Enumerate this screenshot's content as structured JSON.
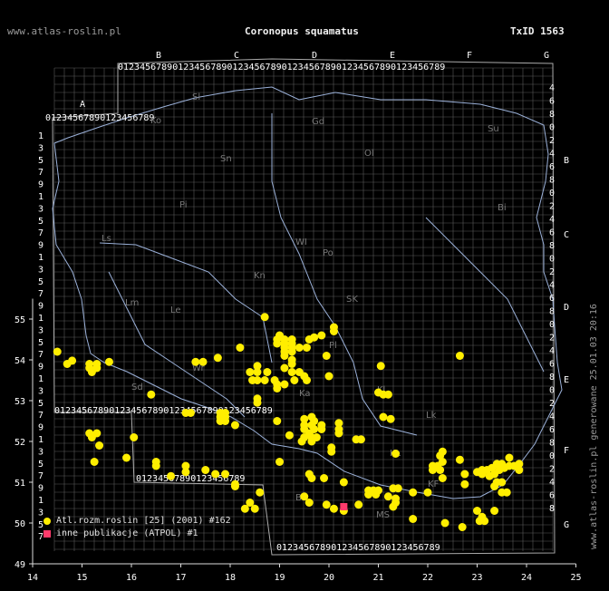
{
  "header": {
    "site": "www.atlas-roslin.pl",
    "species": "Coronopus squamatus",
    "taxid": "TxID 1563"
  },
  "side_label": "www.atlas-roslin.pl generowane 25.01.03 20:16",
  "axes": {
    "lon_ticks": [
      "14",
      "15",
      "16",
      "17",
      "18",
      "19",
      "20",
      "21",
      "22",
      "23",
      "24",
      "25"
    ],
    "lat_ticks": [
      "49",
      "50",
      "51",
      "52",
      "53",
      "54",
      "55"
    ]
  },
  "atpol": {
    "top_letters": [
      "B",
      "C",
      "D",
      "E",
      "F",
      "G"
    ],
    "left_letters": [
      "A"
    ],
    "right_letters": [
      "B",
      "C",
      "D",
      "E",
      "F",
      "G"
    ],
    "digits": "0123456789",
    "row_digits_left": [
      "1",
      "3",
      "5",
      "7",
      "9",
      "1",
      "3",
      "5",
      "7",
      "9",
      "1",
      "3",
      "5",
      "7",
      "9",
      "1",
      "3",
      "5",
      "7",
      "9",
      "1",
      "3",
      "5",
      "7",
      "9",
      "1",
      "3",
      "5",
      "7",
      "9",
      "1",
      "3",
      "5",
      "7"
    ],
    "row_digits_right": [
      "4",
      "6",
      "8",
      "0",
      "2",
      "4",
      "6",
      "8",
      "0",
      "2",
      "4",
      "6",
      "8",
      "0",
      "2",
      "4",
      "6",
      "8",
      "0",
      "2",
      "4",
      "6",
      "8",
      "0",
      "2",
      "4",
      "6",
      "8",
      "0",
      "2",
      "4",
      "6",
      "8"
    ],
    "regions": [
      "Sl",
      "Ko",
      "Gd",
      "Ol",
      "Su",
      "Sn",
      "Bi",
      "Pi",
      "WI",
      "Po",
      "Ls",
      "SK",
      "Kn",
      "Pl",
      "Lm",
      "Le",
      "Wr",
      "Sd",
      "Ka",
      "Kl",
      "Lk",
      "KL",
      "KF",
      "BB",
      "MS"
    ]
  },
  "legend": [
    {
      "marker": "circle",
      "color": "#ffee00",
      "label": "Atl.rozm.roslin [25] (2001) #162"
    },
    {
      "marker": "square",
      "color": "#ff3b6b",
      "label": "inne publikacje (ATPOL) #1"
    }
  ],
  "records": {
    "primary": [
      [
        14.5,
        54.2
      ],
      [
        14.7,
        53.9
      ],
      [
        14.8,
        53.98
      ],
      [
        15.15,
        53.9
      ],
      [
        15.3,
        53.9
      ],
      [
        15.15,
        53.8
      ],
      [
        15.3,
        53.8
      ],
      [
        15.2,
        53.7
      ],
      [
        15.55,
        53.95
      ],
      [
        16.4,
        53.15
      ],
      [
        17.1,
        52.7
      ],
      [
        17.2,
        52.7
      ],
      [
        17.3,
        53.95
      ],
      [
        17.45,
        53.95
      ],
      [
        17.8,
        52.7
      ],
      [
        17.9,
        52.7
      ],
      [
        17.8,
        52.6
      ],
      [
        17.9,
        52.6
      ],
      [
        17.8,
        52.5
      ],
      [
        17.9,
        52.5
      ],
      [
        18.1,
        52.4
      ],
      [
        15.15,
        52.2
      ],
      [
        15.3,
        52.2
      ],
      [
        15.2,
        52.1
      ],
      [
        15.35,
        51.9
      ],
      [
        15.25,
        51.5
      ],
      [
        15.9,
        51.6
      ],
      [
        16.05,
        52.1
      ],
      [
        16.5,
        51.5
      ],
      [
        16.5,
        51.4
      ],
      [
        16.8,
        51.15
      ],
      [
        17.1,
        51.4
      ],
      [
        17.1,
        51.25
      ],
      [
        17.5,
        51.3
      ],
      [
        17.7,
        51.2
      ],
      [
        17.9,
        51.2
      ],
      [
        18.1,
        50.95
      ],
      [
        18.1,
        50.9
      ],
      [
        18.2,
        54.3
      ],
      [
        17.75,
        54.05
      ],
      [
        18.55,
        53.85
      ],
      [
        18.4,
        53.7
      ],
      [
        18.55,
        53.7
      ],
      [
        18.75,
        53.7
      ],
      [
        18.45,
        53.5
      ],
      [
        18.55,
        53.5
      ],
      [
        18.7,
        53.5
      ],
      [
        18.9,
        53.5
      ],
      [
        18.95,
        53.4
      ],
      [
        19.1,
        53.4
      ],
      [
        18.95,
        53.3
      ],
      [
        18.55,
        53.05
      ],
      [
        18.55,
        52.95
      ],
      [
        18.7,
        55.05
      ],
      [
        19.0,
        54.6
      ],
      [
        18.95,
        54.5
      ],
      [
        18.95,
        54.4
      ],
      [
        19.1,
        54.5
      ],
      [
        19.1,
        54.4
      ],
      [
        19.25,
        54.5
      ],
      [
        19.25,
        54.4
      ],
      [
        19.1,
        54.3
      ],
      [
        19.25,
        54.3
      ],
      [
        19.1,
        54.2
      ],
      [
        19.25,
        54.2
      ],
      [
        19.4,
        54.3
      ],
      [
        19.1,
        54.1
      ],
      [
        19.25,
        54.0
      ],
      [
        19.25,
        53.9
      ],
      [
        19.1,
        53.8
      ],
      [
        19.25,
        53.7
      ],
      [
        19.4,
        53.7
      ],
      [
        19.5,
        53.6
      ],
      [
        19.3,
        53.5
      ],
      [
        19.55,
        53.5
      ],
      [
        19.6,
        54.5
      ],
      [
        19.7,
        54.55
      ],
      [
        19.85,
        54.6
      ],
      [
        20.1,
        54.8
      ],
      [
        20.1,
        54.7
      ],
      [
        19.55,
        54.3
      ],
      [
        19.95,
        54.1
      ],
      [
        20.0,
        53.6
      ],
      [
        19.5,
        52.55
      ],
      [
        19.65,
        52.6
      ],
      [
        19.7,
        52.5
      ],
      [
        19.5,
        52.4
      ],
      [
        19.65,
        52.4
      ],
      [
        19.85,
        52.4
      ],
      [
        19.5,
        52.3
      ],
      [
        19.7,
        52.3
      ],
      [
        19.85,
        52.3
      ],
      [
        19.6,
        52.2
      ],
      [
        19.5,
        52.1
      ],
      [
        19.65,
        52.1
      ],
      [
        19.75,
        52.1
      ],
      [
        19.45,
        52.0
      ],
      [
        19.65,
        52.0
      ],
      [
        19.2,
        52.15
      ],
      [
        18.95,
        52.5
      ],
      [
        20.2,
        52.45
      ],
      [
        20.2,
        52.3
      ],
      [
        20.2,
        52.2
      ],
      [
        20.55,
        52.05
      ],
      [
        20.05,
        51.85
      ],
      [
        20.05,
        51.75
      ],
      [
        20.65,
        52.05
      ],
      [
        21.0,
        53.2
      ],
      [
        21.2,
        53.15
      ],
      [
        21.1,
        53.15
      ],
      [
        21.05,
        53.85
      ],
      [
        21.1,
        52.6
      ],
      [
        21.25,
        52.55
      ],
      [
        21.35,
        51.7
      ],
      [
        19.0,
        51.5
      ],
      [
        19.6,
        51.2
      ],
      [
        19.65,
        51.1
      ],
      [
        19.9,
        51.1
      ],
      [
        20.3,
        51.0
      ],
      [
        19.5,
        50.65
      ],
      [
        19.6,
        50.5
      ],
      [
        19.95,
        50.45
      ],
      [
        20.1,
        50.35
      ],
      [
        20.3,
        50.3
      ],
      [
        20.6,
        50.45
      ],
      [
        20.8,
        50.8
      ],
      [
        20.9,
        50.8
      ],
      [
        21.0,
        50.8
      ],
      [
        20.8,
        50.7
      ],
      [
        20.95,
        50.7
      ],
      [
        21.2,
        50.65
      ],
      [
        21.35,
        50.6
      ],
      [
        21.35,
        50.5
      ],
      [
        21.3,
        50.4
      ],
      [
        21.3,
        50.85
      ],
      [
        21.4,
        50.85
      ],
      [
        21.7,
        50.75
      ],
      [
        22.0,
        50.75
      ],
      [
        22.3,
        51.75
      ],
      [
        22.25,
        51.65
      ],
      [
        22.3,
        51.5
      ],
      [
        22.1,
        51.4
      ],
      [
        22.2,
        51.4
      ],
      [
        22.25,
        51.3
      ],
      [
        22.1,
        51.3
      ],
      [
        22.3,
        51.1
      ],
      [
        22.65,
        51.55
      ],
      [
        22.75,
        51.2
      ],
      [
        22.75,
        50.95
      ],
      [
        23.0,
        51.25
      ],
      [
        23.1,
        51.3
      ],
      [
        23.2,
        51.3
      ],
      [
        23.3,
        51.35
      ],
      [
        23.4,
        51.45
      ],
      [
        23.5,
        51.45
      ],
      [
        23.55,
        51.35
      ],
      [
        23.45,
        51.3
      ],
      [
        23.35,
        51.2
      ],
      [
        23.1,
        51.2
      ],
      [
        23.25,
        51.15
      ],
      [
        23.4,
        51.0
      ],
      [
        23.5,
        51.0
      ],
      [
        23.35,
        50.9
      ],
      [
        23.5,
        50.75
      ],
      [
        23.6,
        50.75
      ],
      [
        23.65,
        51.4
      ],
      [
        23.75,
        51.4
      ],
      [
        23.85,
        51.45
      ],
      [
        23.85,
        51.3
      ],
      [
        23.65,
        51.6
      ],
      [
        22.65,
        54.1
      ],
      [
        21.7,
        50.1
      ],
      [
        22.35,
        50.0
      ],
      [
        22.7,
        49.9
      ],
      [
        23.0,
        50.3
      ],
      [
        23.1,
        50.15
      ],
      [
        23.05,
        50.05
      ],
      [
        23.15,
        50.05
      ],
      [
        23.35,
        50.3
      ],
      [
        18.5,
        50.35
      ],
      [
        18.4,
        50.5
      ],
      [
        18.6,
        50.75
      ],
      [
        18.3,
        50.35
      ]
    ],
    "atpol": [
      [
        20.3,
        50.4
      ]
    ]
  }
}
